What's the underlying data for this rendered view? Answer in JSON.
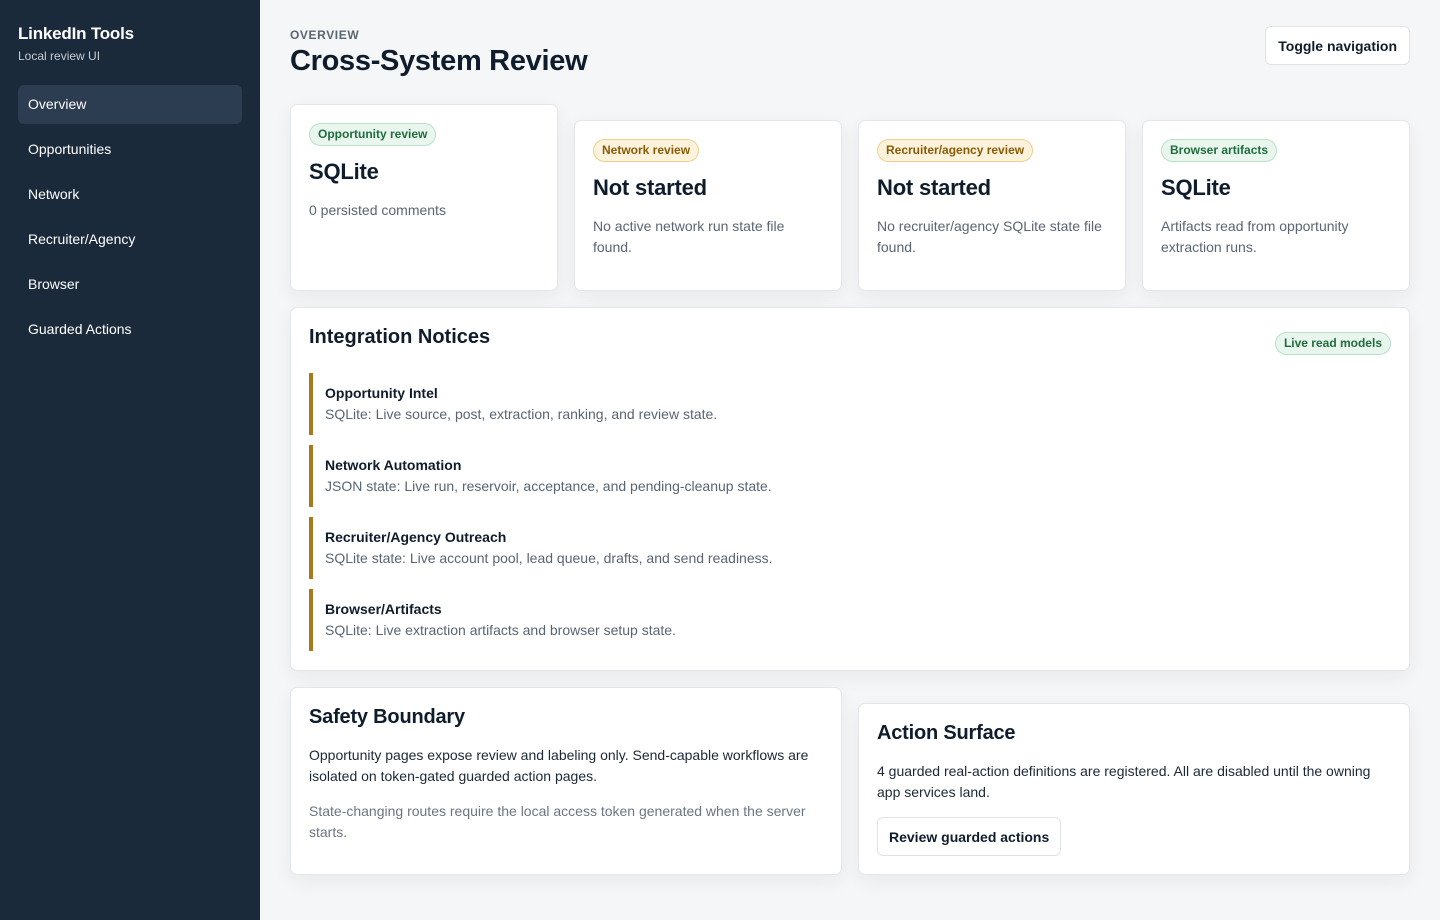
{
  "sidebar": {
    "brand_title": "LinkedIn Tools",
    "brand_subtitle": "Local review UI",
    "items": [
      {
        "label": "Overview",
        "active": true
      },
      {
        "label": "Opportunities"
      },
      {
        "label": "Network"
      },
      {
        "label": "Recruiter/Agency"
      },
      {
        "label": "Browser"
      },
      {
        "label": "Guarded Actions"
      }
    ]
  },
  "header": {
    "eyebrow": "OVERVIEW",
    "title": "Cross-System Review",
    "toggle_label": "Toggle navigation"
  },
  "stats": [
    {
      "badge": "Opportunity review",
      "value": "SQLite",
      "description": "0 persisted comments",
      "badge_tone": "green"
    },
    {
      "badge": "Network review",
      "value": "Not started",
      "description": "No active network run state file found.",
      "badge_tone": "amber"
    },
    {
      "badge": "Recruiter/agency review",
      "value": "Not started",
      "description": "No recruiter/agency SQLite state file found.",
      "badge_tone": "amber"
    },
    {
      "badge": "Browser artifacts",
      "value": "SQLite",
      "description": "Artifacts read from opportunity extraction runs.",
      "badge_tone": "green"
    }
  ],
  "notices": {
    "title": "Integration Notices",
    "badge": "Live read models",
    "items": [
      {
        "title": "Opportunity Intel",
        "description": "SQLite: Live source, post, extraction, ranking, and review state."
      },
      {
        "title": "Network Automation",
        "description": "JSON state: Live run, reservoir, acceptance, and pending-cleanup state."
      },
      {
        "title": "Recruiter/Agency Outreach",
        "description": "SQLite state: Live account pool, lead queue, drafts, and send readiness."
      },
      {
        "title": "Browser/Artifacts",
        "description": "SQLite: Live extraction artifacts and browser setup state."
      }
    ]
  },
  "safety": {
    "title": "Safety Boundary",
    "body": "Opportunity pages expose review and labeling only. Send-capable workflows are isolated on token-gated guarded action pages.",
    "note": "State-changing routes require the local access token generated when the server starts."
  },
  "action_surface": {
    "title": "Action Surface",
    "body": "4 guarded real-action definitions are registered. All are disabled until the owning app services land.",
    "button_label": "Review guarded actions"
  },
  "colors": {
    "sidebar_bg": "#1b2a3b",
    "notice_accent": "#a87a1d",
    "badge_green": "#1f6d3d",
    "badge_amber": "#8a5a06"
  }
}
